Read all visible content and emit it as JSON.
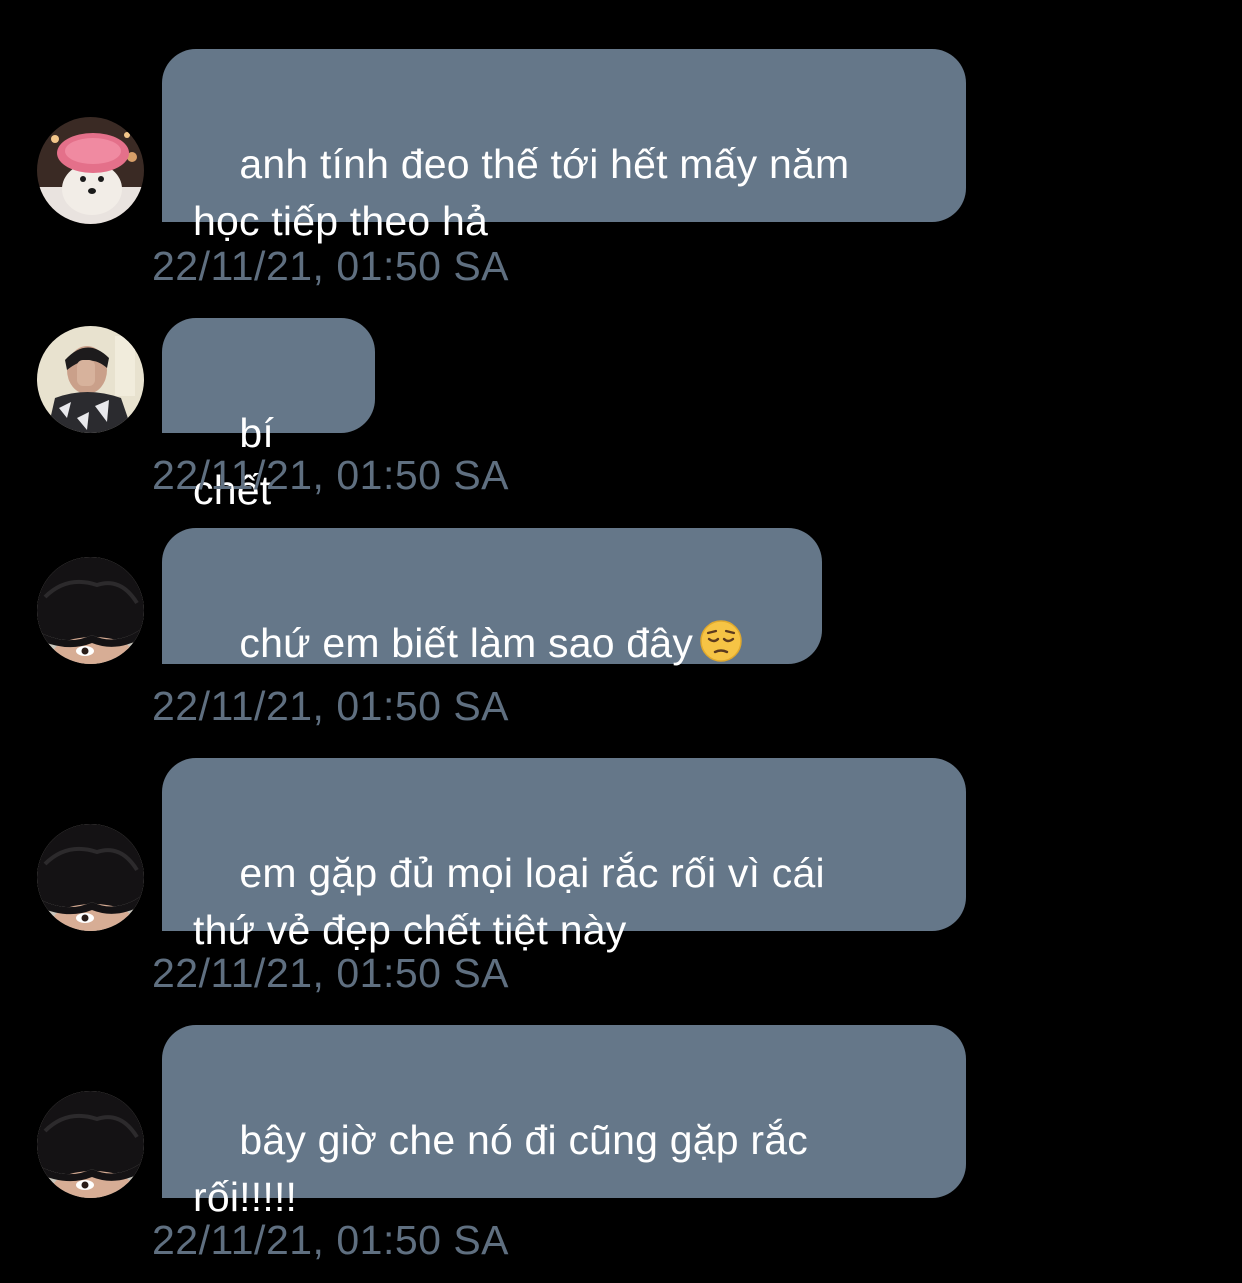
{
  "conversation": {
    "messages": [
      {
        "avatar": "dog-with-bath-cap-avatar",
        "text": "anh tính đeo thế tới hết mấy năm\nhọc tiếp theo hả",
        "timestamp": "22/11/21, 01:50 SA"
      },
      {
        "avatar": "person-covering-face-avatar",
        "text": "bí chết",
        "timestamp": "22/11/21, 01:50 SA"
      },
      {
        "avatar": "dark-hair-peek-avatar",
        "text": "chứ em biết làm sao đây",
        "emoji": "pensive-face-emoji",
        "timestamp": "22/11/21, 01:50 SA"
      },
      {
        "avatar": "dark-hair-peek-avatar",
        "text": "em gặp đủ mọi loại rắc rối vì cái\nthứ vẻ đẹp chết tiệt này",
        "timestamp": "22/11/21, 01:50 SA"
      },
      {
        "avatar": "dark-hair-peek-avatar",
        "text": "bây giờ che nó đi cũng gặp rắc\nrối!!!!!",
        "timestamp": "22/11/21, 01:50 SA"
      }
    ]
  },
  "colors": {
    "background": "#000000",
    "bubble": "#657789",
    "bubble_text": "#ffffff",
    "timestamp": "#5f6f80"
  }
}
